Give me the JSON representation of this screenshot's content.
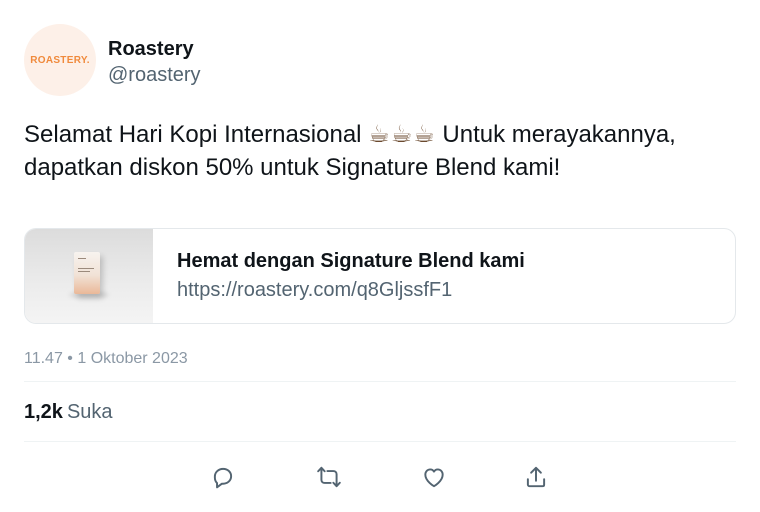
{
  "author": {
    "avatar_text": "ROASTERY.",
    "display_name": "Roastery",
    "handle": "@roastery"
  },
  "tweet": {
    "text_before": "Selamat Hari Kopi Internasional ",
    "emoji": "☕☕☕",
    "text_after": " Untuk merayakannya, dapatkan diskon 50% untuk Signature Blend kami!"
  },
  "link_card": {
    "title": "Hemat dengan Signature Blend kami",
    "url": "https://roastery.com/q8GljssfF1"
  },
  "meta": {
    "timestamp": "11.47 • 1 Oktober 2023"
  },
  "engagement": {
    "likes_count": "1,2k",
    "likes_label": "Suka"
  },
  "actions": [
    "reply-icon",
    "retweet-icon",
    "like-icon",
    "share-icon"
  ],
  "colors": {
    "text_primary": "#0f1419",
    "text_secondary": "#536471",
    "brand_orange": "#f08a3c",
    "avatar_bg": "#fdf0e8"
  }
}
